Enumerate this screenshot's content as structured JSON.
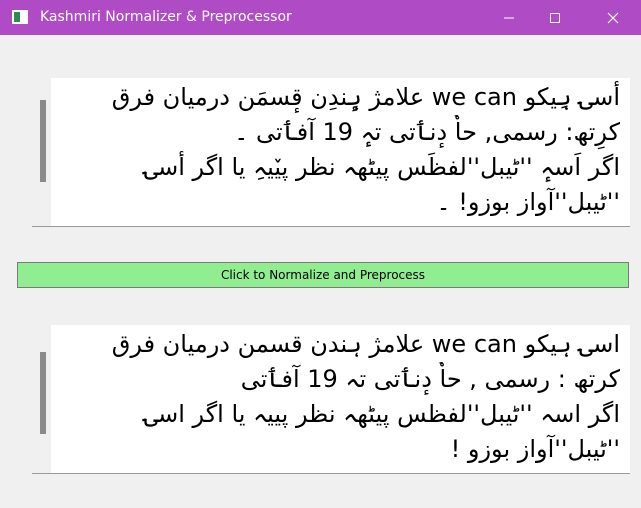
{
  "window": {
    "title": "Kashmiri Normalizer & Preprocessor",
    "titlebar_color": "#b04bc6",
    "controls": {
      "minimize_icon": "minimize-icon",
      "maximize_icon": "maximize-icon",
      "close_icon": "close-icon"
    }
  },
  "input_box": {
    "lines": [
      "أسۍ ہِیکو we can علامژ ہٕندِن قٕسمَن درمیان فرق",
      "کرِتھ: رسمی, حاٗ دٕنٲتی تہٕ 19 آفٲتی ۔",
      "اگر اَسہٕ ''ٹیبل''لفظَس پیٹھہ نظر پیٚیہِ یا اگر أسۍ",
      "''ٹیبل''آواز بوزو! ۔"
    ]
  },
  "action_button": {
    "label": "Click to Normalize and Preprocess",
    "color": "#90ee90"
  },
  "output_box": {
    "lines": [
      "اسۍ ہیکو we can علامژ ہندن قسمن درمیان فرق",
      "کرتھ : رسمی , حاٗ دٕنٲتی تہ 19 آفٲتی",
      "اگر اسہ ''ٹیبل''لفظس پیٹھہ نظر پییہ یا اگر اسۍ",
      "''ٹیبل''آواز بوزو !"
    ]
  }
}
